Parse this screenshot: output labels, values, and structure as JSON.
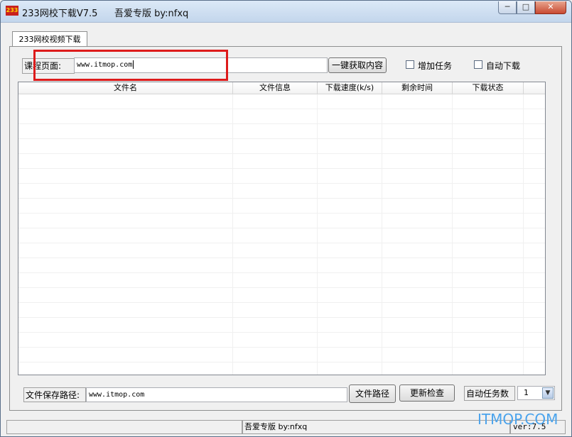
{
  "window": {
    "icon_text": "233",
    "title": "233网校下载V7.5",
    "subtitle": "吾爱专版  by:nfxq",
    "buttons": {
      "minimize": "─",
      "maximize": "□",
      "close": "✕"
    }
  },
  "tabs": [
    {
      "label": "233网校视频下载",
      "selected": true
    }
  ],
  "course": {
    "label": "课程页面:",
    "url_value": "www.itmop.com",
    "fetch_button": "一键获取内容",
    "add_task_label": "增加任务",
    "add_task_checked": false,
    "auto_download_label": "自动下载",
    "auto_download_checked": false
  },
  "table": {
    "columns": [
      "文件名",
      "文件信息",
      "下载速度(k/s)",
      "剩余时间",
      "下载状态"
    ],
    "rows": []
  },
  "save": {
    "label": "文件保存路径:",
    "path_value": "www.itmop.com",
    "path_button": "文件路径",
    "update_button": "更新检查",
    "auto_tasks_label": "自动任务数",
    "auto_tasks_value": "1"
  },
  "status": {
    "left": "",
    "center": "吾爱专版  by:nfxq",
    "version": "ver:7.5"
  },
  "watermark": "ITMOP.COM",
  "colors": {
    "highlight": "#dd1b1b",
    "watermark": "#4aa3ec"
  }
}
